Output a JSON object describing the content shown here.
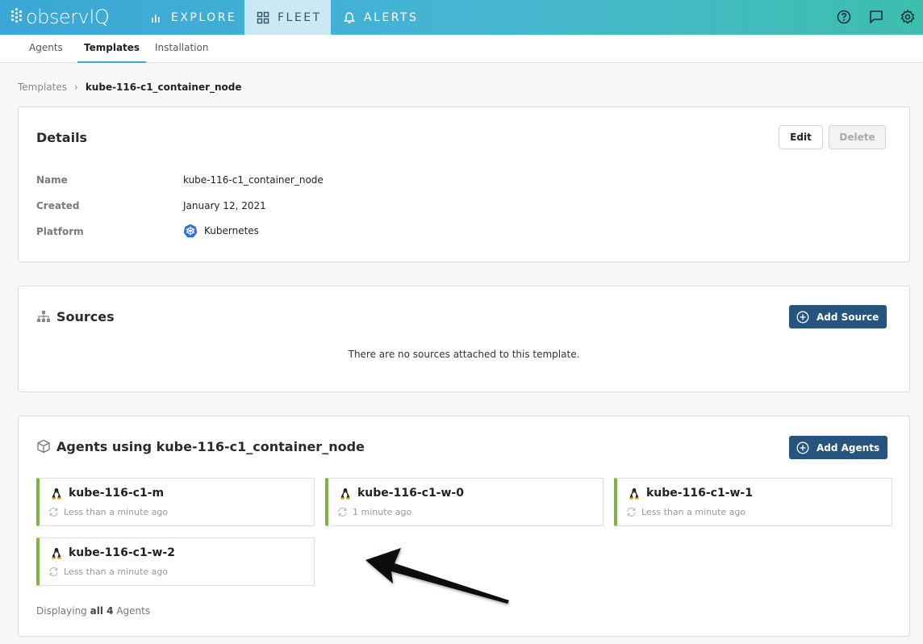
{
  "app": {
    "logo_text": "observIQ"
  },
  "nav": {
    "explore": "EXPLORE",
    "fleet": "FLEET",
    "alerts": "ALERTS"
  },
  "subnav": {
    "agents": "Agents",
    "templates": "Templates",
    "installation": "Installation"
  },
  "breadcrumb": {
    "parent": "Templates",
    "separator": "›",
    "current": "kube-116-c1_container_node"
  },
  "details": {
    "title": "Details",
    "edit_label": "Edit",
    "delete_label": "Delete",
    "fields": [
      {
        "label": "Name",
        "value": "kube-116-c1_container_node"
      },
      {
        "label": "Created",
        "value": "January 12, 2021"
      },
      {
        "label": "Platform",
        "value": "Kubernetes"
      }
    ]
  },
  "sources": {
    "title": "Sources",
    "add_label": "Add Source",
    "empty_text": "There are no sources attached to this template."
  },
  "agents": {
    "title": "Agents using kube-116-c1_container_node",
    "add_label": "Add Agents",
    "items": [
      {
        "name": "kube-116-c1-m",
        "time": "Less than a minute ago"
      },
      {
        "name": "kube-116-c1-w-0",
        "time": "1 minute ago"
      },
      {
        "name": "kube-116-c1-w-1",
        "time": "Less than a minute ago"
      },
      {
        "name": "kube-116-c1-w-2",
        "time": "Less than a minute ago"
      }
    ],
    "footer_prefix": "Displaying",
    "footer_count": "all 4",
    "footer_suffix": "Agents"
  },
  "colors": {
    "accent": "#3ba7d6",
    "primary_button": "#25557f",
    "agent_status": "#7cb342"
  }
}
